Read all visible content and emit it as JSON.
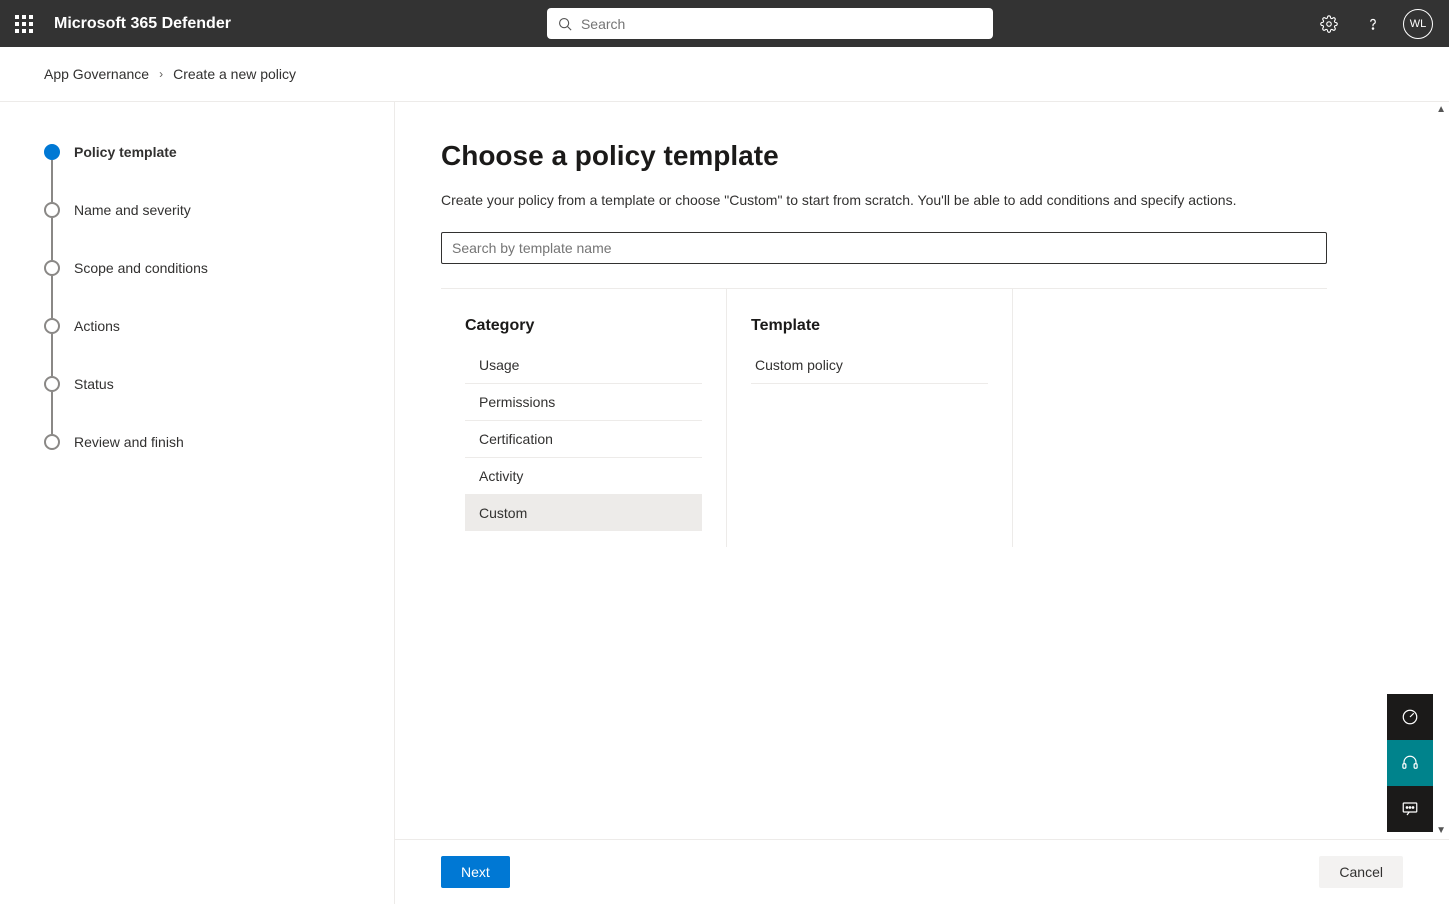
{
  "header": {
    "app_title": "Microsoft 365 Defender",
    "search_placeholder": "Search",
    "user_initials": "WL"
  },
  "breadcrumb": {
    "items": [
      "App Governance",
      "Create a new policy"
    ]
  },
  "stepper": {
    "steps": [
      {
        "label": "Policy template",
        "active": true
      },
      {
        "label": "Name and severity",
        "active": false
      },
      {
        "label": "Scope and conditions",
        "active": false
      },
      {
        "label": "Actions",
        "active": false
      },
      {
        "label": "Status",
        "active": false
      },
      {
        "label": "Review and finish",
        "active": false
      }
    ]
  },
  "main": {
    "title": "Choose a policy template",
    "description": "Create your policy from a template or choose \"Custom\" to start from scratch. You'll be able to add conditions and specify actions.",
    "template_search_placeholder": "Search by template name",
    "category_heading": "Category",
    "template_heading": "Template",
    "categories": [
      {
        "label": "Usage",
        "selected": false
      },
      {
        "label": "Permissions",
        "selected": false
      },
      {
        "label": "Certification",
        "selected": false
      },
      {
        "label": "Activity",
        "selected": false
      },
      {
        "label": "Custom",
        "selected": true
      }
    ],
    "templates": [
      {
        "label": "Custom policy"
      }
    ]
  },
  "footer": {
    "next_label": "Next",
    "cancel_label": "Cancel"
  }
}
